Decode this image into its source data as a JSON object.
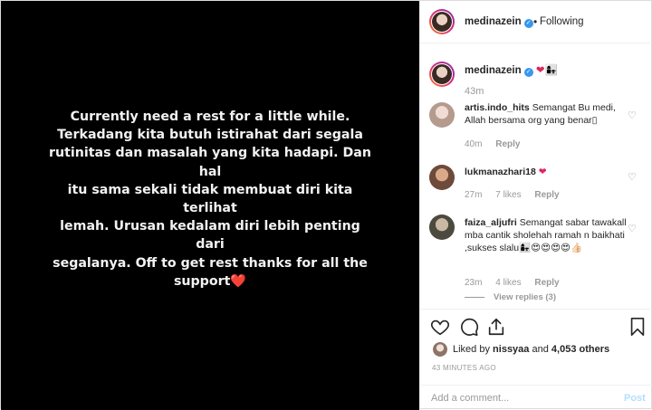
{
  "post_image": {
    "text_lines": [
      "Currently need a rest for a little while.",
      "Terkadang kita butuh istirahat dari segala",
      "rutinitas dan masalah yang kita hadapi. Dan hal",
      "itu sama sekali tidak membuat diri kita terlihat",
      "lemah. Urusan kedalam diri lebih penting dari",
      "segalanya. Off to get rest thanks for all the",
      "support"
    ],
    "trailing_emoji": "❤️"
  },
  "header": {
    "username": "medinazein",
    "separator": "•",
    "follow_status": "Following"
  },
  "caption": {
    "username": "medinazein",
    "text": "❤👩‍👧",
    "time": "43m"
  },
  "comments": [
    {
      "username": "artis.indo_hits",
      "text": "Semangat Bu medi, Allah bersama org yang benar",
      "text_suffix": "▯",
      "time": "40m",
      "likes": "",
      "reply": "Reply"
    },
    {
      "username": "lukmanazhari18",
      "text": "❤",
      "time": "27m",
      "likes": "7 likes",
      "reply": "Reply"
    },
    {
      "username": "faiza_aljufri",
      "text": "Semangat sabar tawakall mba cantik sholehah ramah n baikhati ,sukses slalu👩‍👧😍😍😍😍👍🏻",
      "time": "23m",
      "likes": "4 likes",
      "reply": "Reply",
      "view_replies": "View replies (3)"
    }
  ],
  "actions": {
    "icons": [
      "heart-icon",
      "comment-icon",
      "share-icon",
      "bookmark-icon"
    ]
  },
  "likes": {
    "prefix": "Liked by",
    "user": "nissyaa",
    "conj": "and",
    "others": "4,053 others"
  },
  "post_age": "43 MINUTES AGO",
  "comment_box": {
    "placeholder": "Add a comment...",
    "post_label": "Post"
  },
  "colors": {
    "accent": "#3897f0",
    "heart": "#e0245e",
    "muted": "#999999",
    "post_disabled": "#b2dffc"
  }
}
